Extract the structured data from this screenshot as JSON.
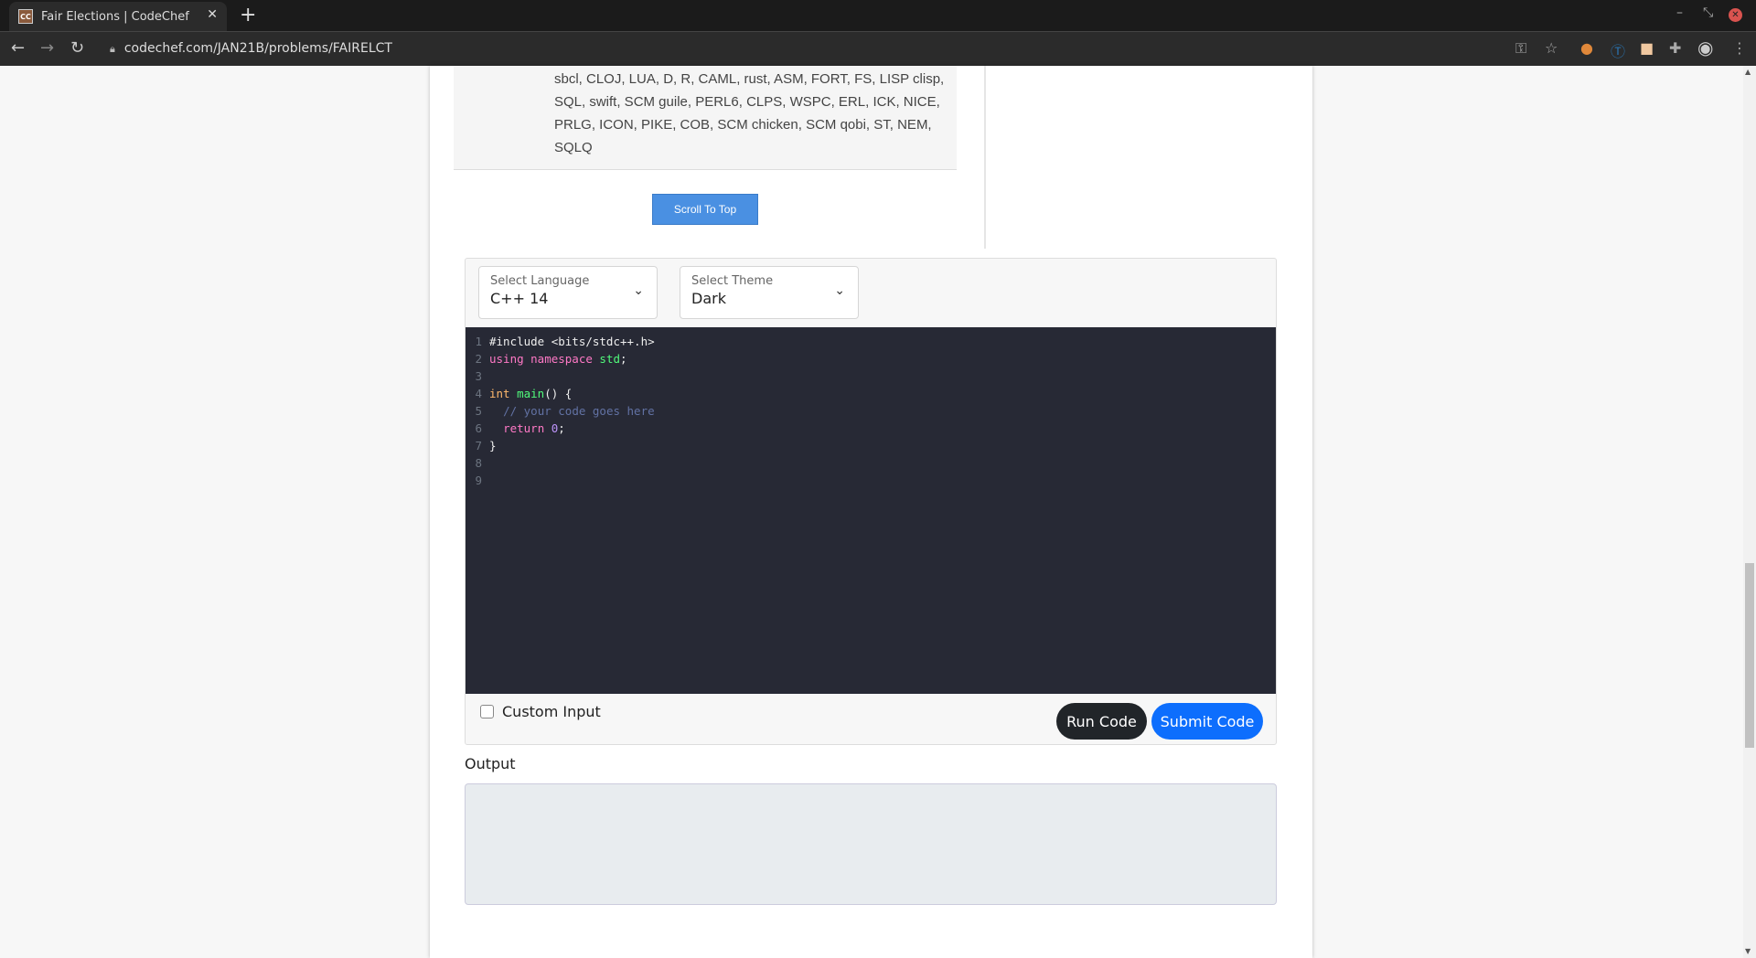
{
  "browser": {
    "tab_title": "Fair Elections | CodeChef",
    "favicon": "CC",
    "url": "codechef.com/JAN21B/problems/FAIRELCT"
  },
  "languages_text": "sbcl, CLOJ, LUA, D, R, CAML, rust, ASM, FORT, FS, LISP clisp, SQL, swift, SCM guile, PERL6, CLPS, WSPC, ERL, ICK, NICE, PRLG, ICON, PIKE, COB, SCM chicken, SCM qobi, ST, NEM, SQLQ",
  "scroll_top_label": "Scroll To Top",
  "editor": {
    "language": {
      "label": "Select Language",
      "value": "C++ 14"
    },
    "theme": {
      "label": "Select Theme",
      "value": "Dark"
    },
    "lines": [
      {
        "n": "1",
        "parts": [
          [
            "",
            "#include <bits/stdc++.h>"
          ]
        ]
      },
      {
        "n": "2",
        "parts": [
          [
            "kw",
            "using namespace "
          ],
          [
            "fn",
            "std"
          ],
          [
            "",
            "; "
          ]
        ]
      },
      {
        "n": "3",
        "parts": []
      },
      {
        "n": "4",
        "parts": [
          [
            "ty",
            "int "
          ],
          [
            "fn",
            "main"
          ],
          [
            "",
            "() {"
          ]
        ]
      },
      {
        "n": "5",
        "parts": [
          [
            "",
            "  "
          ],
          [
            "cm",
            "// your code goes here"
          ]
        ]
      },
      {
        "n": "6",
        "parts": [
          [
            "",
            "  "
          ],
          [
            "kw",
            "return "
          ],
          [
            "nm",
            "0"
          ],
          [
            "",
            ";"
          ]
        ]
      },
      {
        "n": "7",
        "parts": [
          [
            "",
            "}"
          ]
        ]
      },
      {
        "n": "8",
        "parts": []
      },
      {
        "n": "9",
        "parts": []
      }
    ],
    "custom_input_label": "Custom Input",
    "custom_input_checked": false,
    "run_label": "Run Code",
    "submit_label": "Submit Code"
  },
  "output_label": "Output",
  "colors": {
    "run": "#212529",
    "submit": "#0d6efd",
    "editor_bg": "#272935",
    "scroll_top": "#4a90e2"
  }
}
